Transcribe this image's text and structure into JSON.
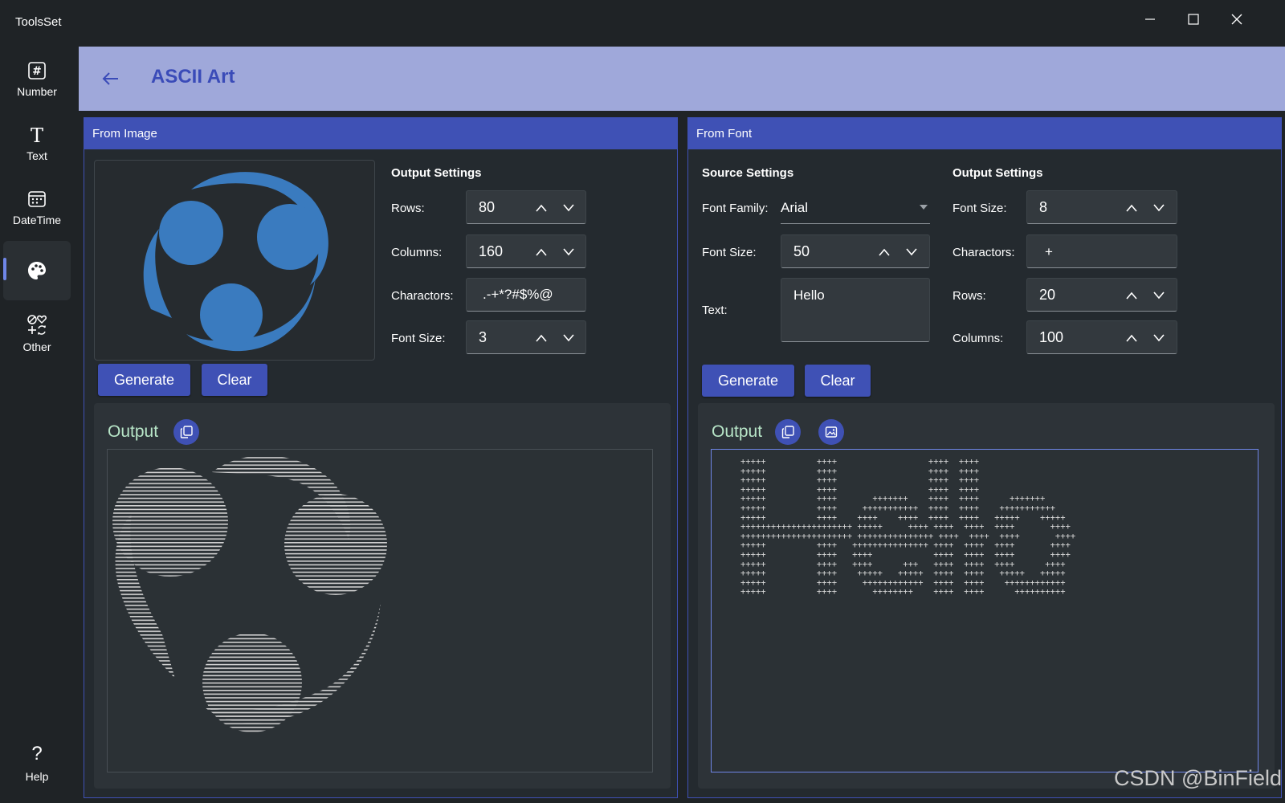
{
  "app": {
    "title": "ToolsSet"
  },
  "window": {
    "minimize_icon": "minimize-icon",
    "maximize_icon": "maximize-icon",
    "close_icon": "close-icon"
  },
  "sidebar": {
    "items": [
      {
        "label": "Number",
        "icon": "hash-icon"
      },
      {
        "label": "Text",
        "icon": "text-icon"
      },
      {
        "label": "DateTime",
        "icon": "calendar-icon"
      },
      {
        "label": "",
        "icon": "palette-icon",
        "active": true
      },
      {
        "label": "Other",
        "icon": "shapes-icon"
      }
    ],
    "help_label": "Help"
  },
  "header": {
    "title": "ASCII Art"
  },
  "from_image": {
    "title": "From Image",
    "output_settings_title": "Output Settings",
    "rows_label": "Rows:",
    "rows_value": "80",
    "columns_label": "Columns:",
    "columns_value": "160",
    "charactors_label": "Charactors:",
    "charactors_value": ".-+*?#$%@",
    "font_size_label": "Font Size:",
    "font_size_value": "3",
    "generate_label": "Generate",
    "clear_label": "Clear",
    "output_label": "Output"
  },
  "from_font": {
    "title": "From Font",
    "source_settings_title": "Source Settings",
    "font_family_label": "Font Family:",
    "font_family_value": "Arial",
    "font_size_label": "Font Size:",
    "font_size_value": "50",
    "text_label": "Text:",
    "text_value": "Hello",
    "output_settings_title": "Output Settings",
    "out_font_size_label": "Font Size:",
    "out_font_size_value": "8",
    "charactors_label": "Charactors:",
    "charactors_value": "+",
    "rows_label": "Rows:",
    "rows_value": "20",
    "columns_label": "Columns:",
    "columns_value": "100",
    "generate_label": "Generate",
    "clear_label": "Clear",
    "output_label": "Output",
    "ascii_lines": [
      "+++++          ++++                  ++++  ++++",
      "+++++          ++++                  ++++  ++++",
      "+++++          ++++                  ++++  ++++",
      "+++++          ++++                  ++++  ++++",
      "+++++          ++++       +++++++    ++++  ++++      +++++++",
      "+++++          ++++     +++++++++++  ++++  ++++    +++++++++++",
      "+++++          ++++    ++++    ++++  ++++  ++++   +++++    +++++",
      "++++++++++++++++++++++ +++++     ++++ ++++  ++++  ++++       ++++",
      "++++++++++++++++++++++ +++++++++++++++ ++++  ++++  ++++       ++++",
      "+++++          ++++   +++++++++++++++ ++++  ++++  ++++       ++++",
      "+++++          ++++   ++++            ++++  ++++  ++++       ++++",
      "+++++          ++++   ++++      +++   ++++  ++++  ++++      ++++",
      "+++++          ++++    +++++   +++++  ++++  ++++   +++++   +++++",
      "+++++          ++++     ++++++++++++  ++++  ++++    ++++++++++++",
      "+++++          ++++       ++++++++    ++++  ++++      ++++++++++"
    ]
  },
  "watermark": "CSDN @BinField",
  "colors": {
    "accent": "#3f51b5",
    "header_bg": "#9fa8da",
    "logo_blue": "#3a7bbf",
    "output_title": "#b8e6c8"
  }
}
